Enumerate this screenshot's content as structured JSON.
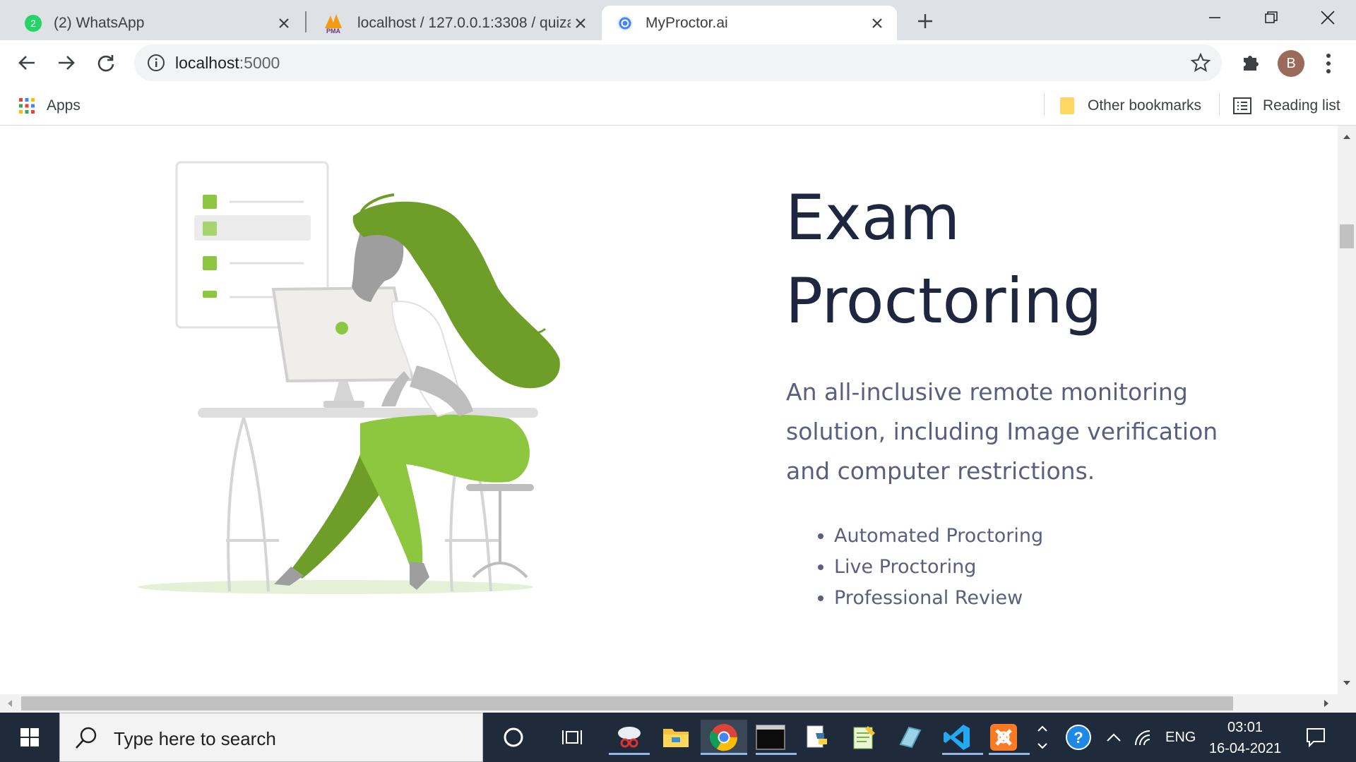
{
  "browser": {
    "tabs": [
      {
        "title": "(2) WhatsApp",
        "icon": "whatsapp-icon",
        "badge": "2",
        "active": false
      },
      {
        "title": "localhost / 127.0.0.1:3308 / quiza",
        "icon": "phpmyadmin-icon",
        "icon_label": "PMA",
        "active": false
      },
      {
        "title": "MyProctor.ai",
        "icon": "chrome-page-icon",
        "active": true
      }
    ],
    "address": {
      "host": "localhost",
      "port": ":5000"
    },
    "profile_initial": "B",
    "bookmarks": {
      "apps_label": "Apps",
      "other_label": "Other bookmarks",
      "reading_list_label": "Reading list"
    }
  },
  "page": {
    "hero": {
      "title_line1": "Exam",
      "title_line2": "Proctoring",
      "description": "An all-inclusive remote monitoring solution, including Image verification and computer restrictions.",
      "features": [
        "Automated Proctoring",
        "Live Proctoring",
        "Professional Review"
      ]
    }
  },
  "taskbar": {
    "search_placeholder": "Type here to search",
    "pinned": [
      "snipping-tool-icon",
      "file-explorer-icon",
      "chrome-icon",
      "terminal-icon",
      "python-icon",
      "notepad-icon",
      "xlauncher-icon",
      "vscode-icon",
      "xampp-icon"
    ],
    "tray": {
      "language": "ENG",
      "time": "03:01",
      "date": "16-04-2021"
    }
  },
  "colors": {
    "accent_green": "#8dc63f",
    "dark_green": "#6e9e27",
    "title_navy": "#1e2640",
    "body_text": "#5a5f80"
  }
}
